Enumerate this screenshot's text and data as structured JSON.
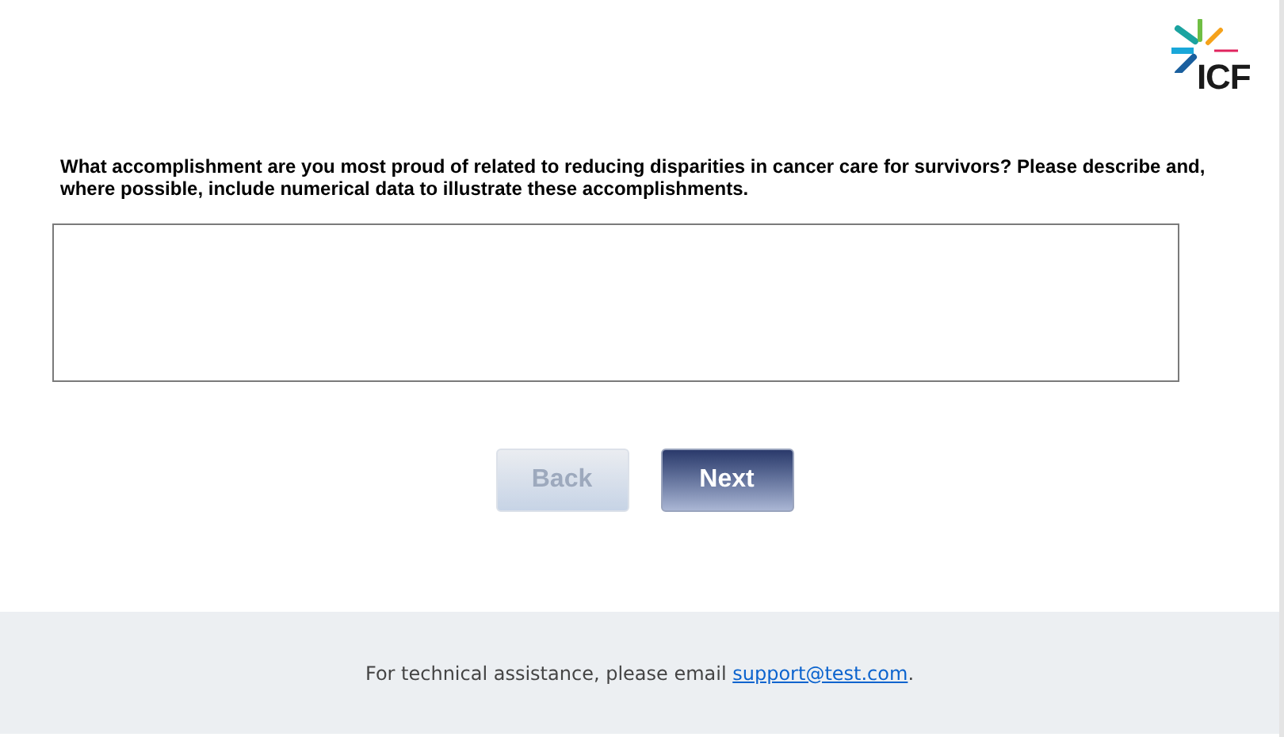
{
  "logo": {
    "text": "ICF"
  },
  "question": "What accomplishment are you most proud of related to reducing disparities in cancer care for survivors? Please describe and, where possible, include numerical data to illustrate these accomplishments.",
  "buttons": [
    {
      "label": "Back",
      "kind": "back",
      "disabled": true
    },
    {
      "label": "Next",
      "kind": "next",
      "disabled": false
    }
  ],
  "footer": {
    "text": "For technical assistance, please email ",
    "link": "support@test.com",
    "after": "."
  }
}
